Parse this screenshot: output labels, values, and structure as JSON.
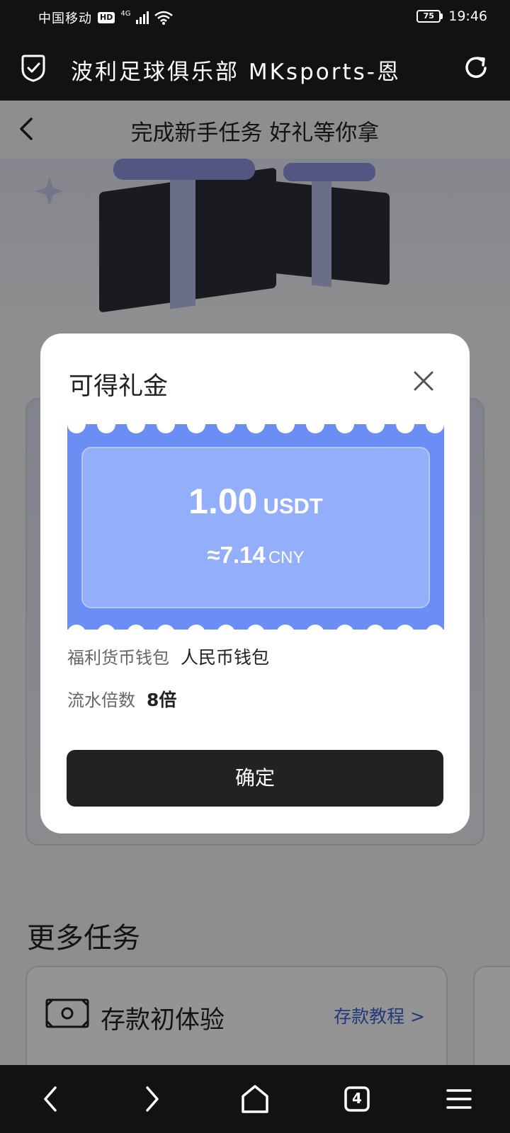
{
  "status_bar": {
    "carrier": "中国移动",
    "hd": "HD",
    "network": "4G",
    "battery": "75",
    "time": "19:46"
  },
  "browser": {
    "title": "波利足球俱乐部  MKsports-恩",
    "shield_icon": "shield-check-icon",
    "refresh_icon": "refresh-icon"
  },
  "page": {
    "nav_title": "完成新手任务 好礼等你拿",
    "more_tasks_title": "更多任务",
    "task_card": {
      "label": "存款初体验",
      "link": "存款教程 >"
    }
  },
  "modal": {
    "title": "可得礼金",
    "amount": "1.00",
    "amount_unit": "USDT",
    "cny_amount": "≈7.14",
    "cny_unit": "CNY",
    "wallet_label": "福利货币钱包",
    "wallet_value": "人民币钱包",
    "multiplier_label": "流水倍数",
    "multiplier_value": "8倍",
    "confirm_label": "确定"
  },
  "bottom_nav": {
    "tab_count": "4"
  },
  "colors": {
    "ticket": "#6b8ef5",
    "ticket_inner": "#93aefa",
    "dark": "#121212",
    "link": "#3b63d4"
  }
}
